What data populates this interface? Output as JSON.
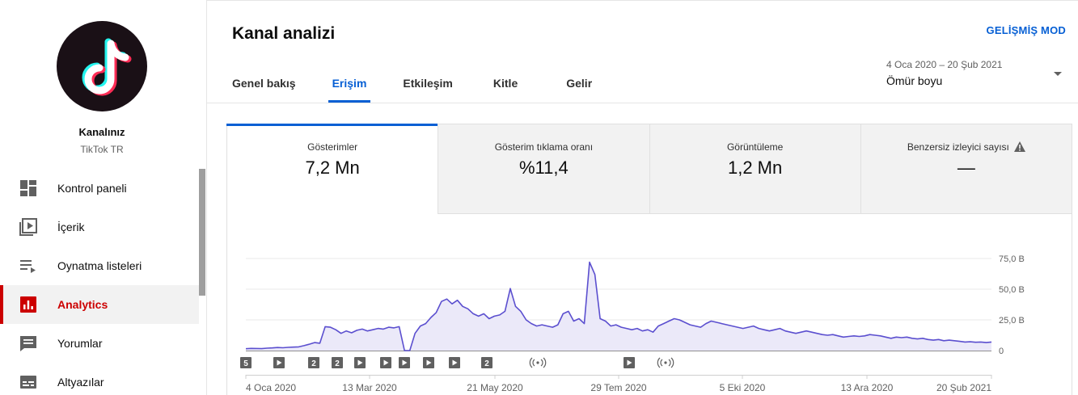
{
  "sidebar": {
    "channel_title": "Kanalınız",
    "channel_subtitle": "TikTok TR",
    "items": [
      {
        "label": "Kontrol paneli",
        "icon": "dashboard-icon"
      },
      {
        "label": "İçerik",
        "icon": "content-icon"
      },
      {
        "label": "Oynatma listeleri",
        "icon": "playlist-icon"
      },
      {
        "label": "Analytics",
        "icon": "analytics-icon",
        "active": true
      },
      {
        "label": "Yorumlar",
        "icon": "comments-icon"
      },
      {
        "label": "Altyazılar",
        "icon": "subtitles-icon"
      }
    ]
  },
  "header": {
    "title": "Kanal analizi",
    "advanced_mode": "GELİŞMİŞ MOD",
    "tabs": [
      {
        "label": "Genel bakış"
      },
      {
        "label": "Erişim",
        "active": true
      },
      {
        "label": "Etkileşim"
      },
      {
        "label": "Kitle"
      },
      {
        "label": "Gelir"
      }
    ],
    "date_range": "4 Oca 2020 – 20 Şub 2021",
    "date_value": "Ömür boyu"
  },
  "metrics": [
    {
      "label": "Gösterimler",
      "value": "7,2 Mn",
      "active": true
    },
    {
      "label": "Gösterim tıklama oranı",
      "value": "%11,4"
    },
    {
      "label": "Görüntüleme",
      "value": "1,2 Mn"
    },
    {
      "label": "Benzersiz izleyici sayısı",
      "value": "—"
    }
  ],
  "colors": {
    "accent": "#065fd4",
    "active_nav": "#cc0000",
    "series_line": "#5b4fcf",
    "series_fill": "#ebe9f9"
  },
  "chart_data": {
    "type": "area",
    "x_range": [
      "4 Oca 2020",
      "20 Şub 2021"
    ],
    "x_tick_labels": [
      "4 Oca 2020",
      "13 Mar 2020",
      "21 May 2020",
      "29 Tem 2020",
      "5 Eki 2020",
      "13 Ara 2020",
      "20 Şub 2021"
    ],
    "y_tick_labels": [
      "0",
      "25,0 B",
      "50,0 B",
      "75,0 B"
    ],
    "ylim": [
      0,
      75000
    ],
    "grid": true,
    "series": [
      {
        "values": [
          1500,
          1800,
          1700,
          1600,
          2000,
          2200,
          2500,
          2300,
          2600,
          2800,
          3000,
          4000,
          5200,
          6500,
          6000,
          19500,
          19000,
          17000,
          14000,
          16000,
          14500,
          16500,
          17500,
          16000,
          17000,
          18000,
          17500,
          19000,
          18500,
          19500,
          0,
          0,
          14000,
          20000,
          22000,
          27000,
          31000,
          40000,
          42000,
          38000,
          41000,
          36000,
          34000,
          30000,
          28000,
          30000,
          26000,
          28000,
          29000,
          32000,
          50500,
          36000,
          32000,
          25000,
          22000,
          20000,
          21000,
          20000,
          19000,
          21000,
          30000,
          32000,
          24000,
          26000,
          22000,
          72000,
          62000,
          26000,
          24000,
          20000,
          21000,
          19000,
          18000,
          17000,
          18000,
          16000,
          17000,
          15000,
          20000,
          22000,
          24000,
          26000,
          25000,
          23000,
          21000,
          20000,
          19000,
          22000,
          24000,
          23000,
          22000,
          21000,
          20000,
          19000,
          18000,
          19000,
          20000,
          18000,
          17000,
          16000,
          17000,
          18000,
          16000,
          15000,
          14000,
          15000,
          16000,
          15000,
          14000,
          13000,
          12500,
          13000,
          12000,
          11000,
          11500,
          12000,
          11500,
          12000,
          13000,
          12500,
          12000,
          11000,
          10000,
          11000,
          10500,
          11000,
          10000,
          9500,
          10000,
          9000,
          8500,
          9000,
          8000,
          8500,
          8000,
          7500,
          7000,
          7200,
          6800,
          7000,
          6500,
          7000
        ]
      }
    ],
    "markers": [
      {
        "type": "badge",
        "label": "5"
      },
      {
        "type": "play"
      },
      {
        "type": "badge",
        "label": "2"
      },
      {
        "type": "badge",
        "label": "2"
      },
      {
        "type": "play"
      },
      {
        "type": "play"
      },
      {
        "type": "play"
      },
      {
        "type": "play"
      },
      {
        "type": "play"
      },
      {
        "type": "badge",
        "label": "2"
      },
      {
        "type": "live"
      },
      {
        "type": "play"
      },
      {
        "type": "live"
      }
    ]
  }
}
